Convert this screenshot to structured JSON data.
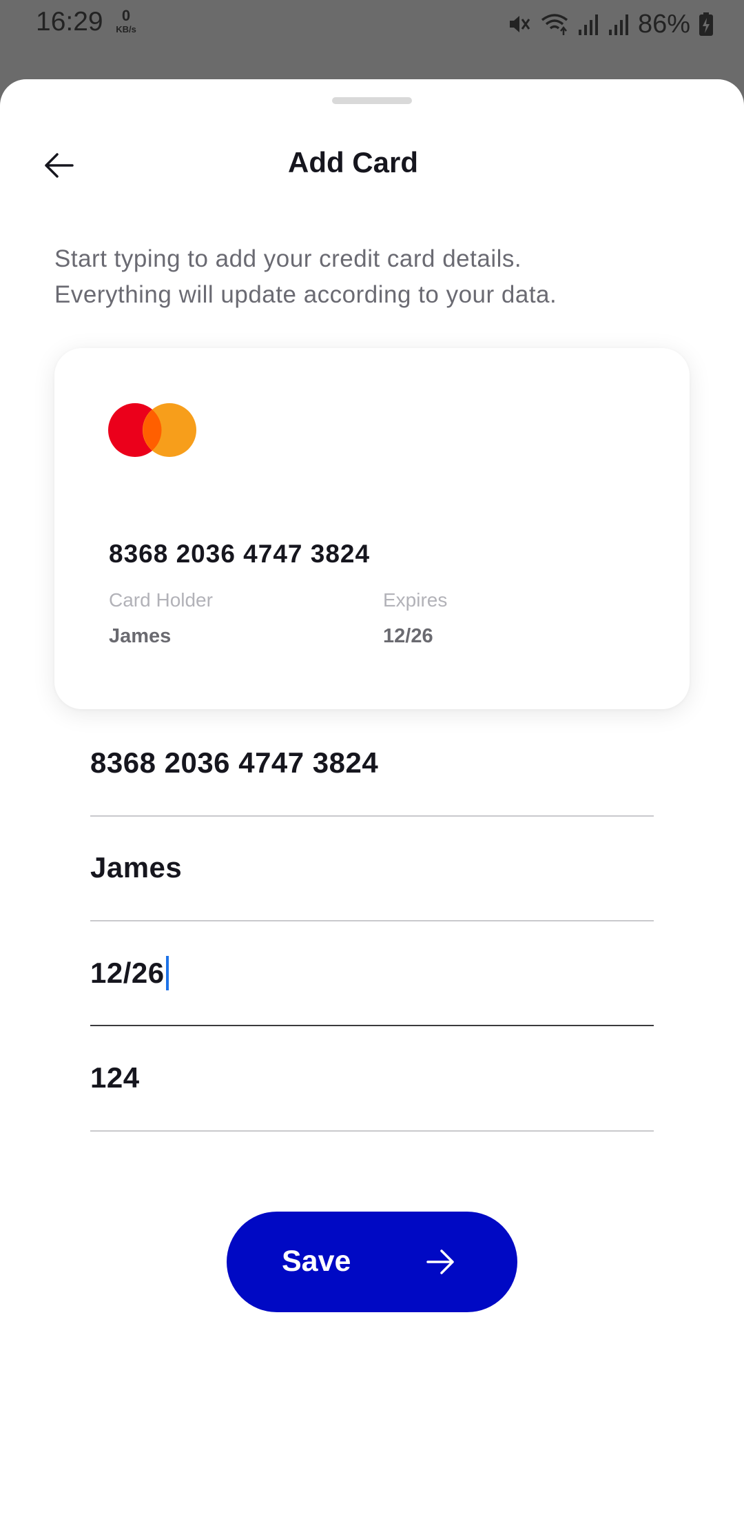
{
  "status_bar": {
    "time": "16:29",
    "net_speed": "0",
    "net_unit": "KB/s",
    "battery": "86%",
    "icons": [
      "mute-icon",
      "wifi-icon",
      "signal-icon",
      "signal-icon",
      "battery-charging-icon"
    ]
  },
  "header": {
    "title": "Add Card",
    "back_icon": "arrow-left-icon"
  },
  "subtitle": {
    "line1": "Start typing to add your credit card details.",
    "line2": "Everything will update according to your data."
  },
  "card_preview": {
    "brand_icon": "mastercard-logo",
    "number": "8368 2036 4747 3824",
    "holder_label": "Card Holder",
    "holder_value": "James",
    "expires_label": "Expires",
    "expires_value": "12/26"
  },
  "form": {
    "card_number": "8368 2036 4747 3824",
    "holder_name": "James",
    "expiry": "12/26",
    "cvv": "124"
  },
  "save_button": {
    "label": "Save",
    "icon": "arrow-right-icon",
    "color": "#0009c4"
  },
  "colors": {
    "mastercard_red": "#eb001b",
    "mastercard_orange": "#f79e1b",
    "mastercard_overlap": "#ff5f00",
    "cursor": "#1e73e8"
  }
}
